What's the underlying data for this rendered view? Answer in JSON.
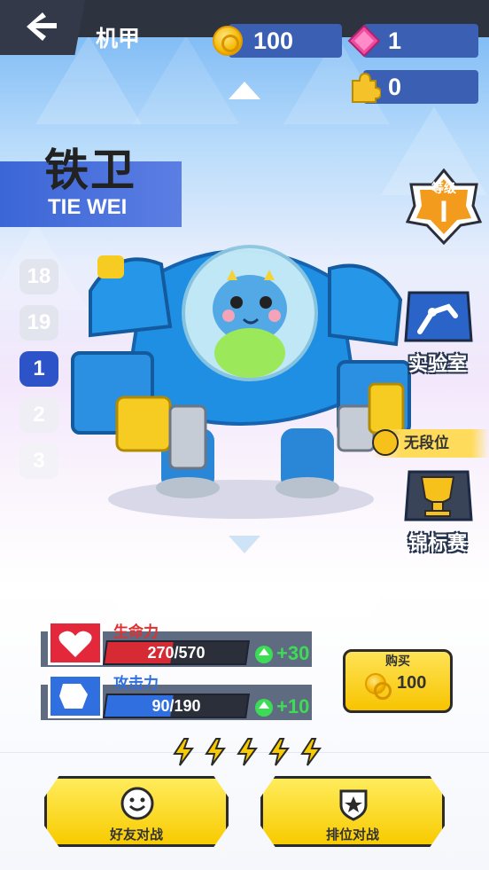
{
  "header": {
    "title": "机甲",
    "coins": "100",
    "gems": "1",
    "puzzle_pieces": "0"
  },
  "mech": {
    "name_cn": "铁卫",
    "name_en": "TIE WEI"
  },
  "level_list": [
    "18",
    "19",
    "1",
    "2",
    "3"
  ],
  "selected_level": "1",
  "rank": {
    "label": "等级",
    "value": "I"
  },
  "side_buttons": {
    "lab": "实验室",
    "segment": "无段位",
    "championship": "锦标赛"
  },
  "stats": {
    "hp": {
      "label": "生命力",
      "value": "270/570",
      "fraction": 0.47,
      "bonus": "+30",
      "color": "#d62a34"
    },
    "atk": {
      "label": "攻击力",
      "value": "90/190",
      "fraction": 0.47,
      "bonus": "+10",
      "color": "#2f6fe0"
    }
  },
  "buy": {
    "label": "购买",
    "price": "100"
  },
  "energy_count": 5,
  "buttons": {
    "friend_battle": "好友对战",
    "ranked_battle": "排位对战"
  },
  "colors": {
    "accent_yellow": "#f8cb00",
    "banner_blue": "#3b66d6"
  }
}
